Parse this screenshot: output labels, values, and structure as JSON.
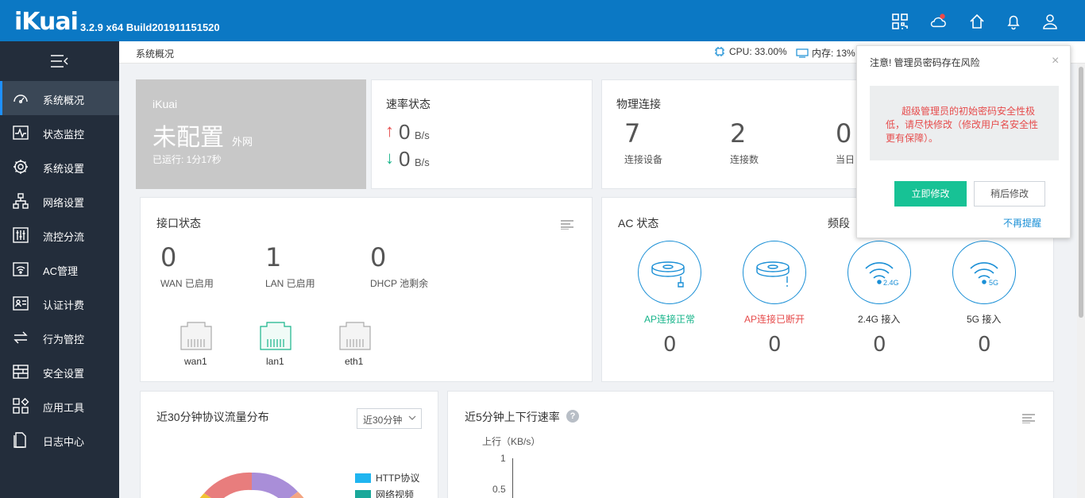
{
  "header": {
    "logo": "iKuai",
    "version": "3.2.9 x64 Build201911151520",
    "icons": [
      "qrcode-icon",
      "cloud-icon",
      "home-icon",
      "bell-icon",
      "user-icon"
    ]
  },
  "sidebar": {
    "items": [
      {
        "label": "系统概况",
        "icon": "dashboard-icon",
        "active": true
      },
      {
        "label": "状态监控",
        "icon": "monitor-icon"
      },
      {
        "label": "系统设置",
        "icon": "gear-icon"
      },
      {
        "label": "网络设置",
        "icon": "network-icon"
      },
      {
        "label": "流控分流",
        "icon": "sliders-icon"
      },
      {
        "label": "AC管理",
        "icon": "wifi-icon"
      },
      {
        "label": "认证计费",
        "icon": "idcard-icon"
      },
      {
        "label": "行为管控",
        "icon": "arrows-icon"
      },
      {
        "label": "安全设置",
        "icon": "firewall-icon"
      },
      {
        "label": "应用工具",
        "icon": "tools-icon"
      },
      {
        "label": "日志中心",
        "icon": "log-icon"
      }
    ]
  },
  "crumbbar": {
    "breadcrumb": "系统概况",
    "cpu": "CPU: 33.00%",
    "mem": "内存: 13%"
  },
  "wan": {
    "brand": "iKuai",
    "status": "未配置",
    "status_suffix": "外网",
    "uptime": "已运行: 1分17秒"
  },
  "rate": {
    "title": "速率状态",
    "up_value": "0",
    "up_unit": "B/s",
    "down_value": "0",
    "down_unit": "B/s"
  },
  "physical": {
    "title": "物理连接",
    "devices_value": "7",
    "devices_label": "连接设备",
    "connections_value": "2",
    "connections_label": "连接数",
    "today_value": "0",
    "today_label": "当日"
  },
  "interfaces": {
    "title": "接口状态",
    "wan_value": "0",
    "wan_label": "WAN 已启用",
    "lan_value": "1",
    "lan_label": "LAN 已启用",
    "dhcp_value": "0",
    "dhcp_label": "DHCP 池剩余",
    "ports": [
      {
        "name": "wan1",
        "active": false
      },
      {
        "name": "lan1",
        "active": true
      },
      {
        "name": "eth1",
        "active": false
      }
    ]
  },
  "ac": {
    "title": "AC 状态",
    "band_title": "频段",
    "items": [
      {
        "label": "AP连接正常",
        "value": "0",
        "color": "#17b48a"
      },
      {
        "label": "AP连接已断开",
        "value": "0",
        "color": "#e64c4c"
      },
      {
        "label": "2.4G 接入",
        "value": "0",
        "color": "#333333",
        "badge": "2.4G"
      },
      {
        "label": "5G 接入",
        "value": "0",
        "color": "#333333",
        "badge": "5G"
      }
    ]
  },
  "protocol": {
    "title": "近30分钟协议流量分布",
    "select_value": "近30分钟",
    "legend": [
      {
        "name": "HTTP协议",
        "color": "#1fb5f0"
      },
      {
        "name": "网络视频",
        "color": "#1aa89a"
      }
    ],
    "ring_colors": [
      "#e87d7d",
      "#a98ed8",
      "#f1c232",
      "#f4a582"
    ]
  },
  "speed": {
    "title": "近5分钟上下行速率",
    "ylabel": "上行（KB/s）",
    "ticks": [
      "1",
      "0.5"
    ]
  },
  "popup": {
    "title": "注意! 管理员密码存在风险",
    "close": "×",
    "message": "超级管理员的初始密码安全性极低，请尽快修改（修改用户名安全性更有保障）。",
    "primary_button": "立即修改",
    "secondary_button": "稍后修改",
    "no_remind": "不再提醒"
  }
}
